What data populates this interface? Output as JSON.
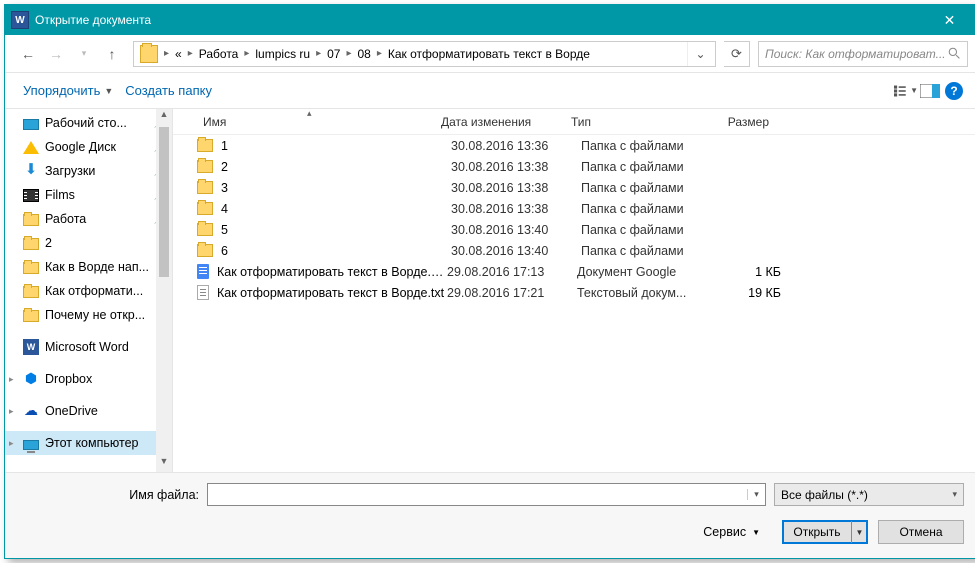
{
  "title": "Открытие документа",
  "breadcrumbs": {
    "prefix": "«",
    "items": [
      "Работа",
      "lumpics ru",
      "07",
      "08",
      "Как отформатировать текст в Ворде"
    ]
  },
  "search_placeholder": "Поиск: Как отформатироват...",
  "toolbar": {
    "organize": "Упорядочить",
    "new_folder": "Создать папку"
  },
  "sidebar": [
    {
      "label": "Рабочий сто...",
      "icon": "desktop",
      "pin": true
    },
    {
      "label": "Google Диск",
      "icon": "gdrive",
      "pin": true
    },
    {
      "label": "Загрузки",
      "icon": "down",
      "pin": true
    },
    {
      "label": "Films",
      "icon": "film",
      "pin": true
    },
    {
      "label": "Работа",
      "icon": "folder",
      "pin": true
    },
    {
      "label": "2",
      "icon": "folder",
      "pin": false
    },
    {
      "label": "Как в Ворде нап...",
      "icon": "folder",
      "pin": false
    },
    {
      "label": "Как отформати...",
      "icon": "folder",
      "pin": false
    },
    {
      "label": "Почему не откр...",
      "icon": "folder",
      "pin": false
    },
    {
      "label": "",
      "icon": "",
      "pin": false
    },
    {
      "label": "Microsoft Word",
      "icon": "word",
      "pin": false
    },
    {
      "label": "",
      "icon": "",
      "pin": false
    },
    {
      "label": "Dropbox",
      "icon": "dropbox",
      "pin": false,
      "caret": true
    },
    {
      "label": "",
      "icon": "",
      "pin": false
    },
    {
      "label": "OneDrive",
      "icon": "onedrive",
      "pin": false,
      "caret": true
    },
    {
      "label": "",
      "icon": "",
      "pin": false
    },
    {
      "label": "Этот компьютер",
      "icon": "pc",
      "pin": false,
      "caret": true,
      "selected": true
    }
  ],
  "columns": {
    "name": "Имя",
    "date": "Дата изменения",
    "type": "Тип",
    "size": "Размер"
  },
  "files": [
    {
      "name": "1",
      "date": "30.08.2016 13:36",
      "type": "Папка с файлами",
      "size": "",
      "ico": "folder"
    },
    {
      "name": "2",
      "date": "30.08.2016 13:38",
      "type": "Папка с файлами",
      "size": "",
      "ico": "folder"
    },
    {
      "name": "3",
      "date": "30.08.2016 13:38",
      "type": "Папка с файлами",
      "size": "",
      "ico": "folder"
    },
    {
      "name": "4",
      "date": "30.08.2016 13:38",
      "type": "Папка с файлами",
      "size": "",
      "ico": "folder"
    },
    {
      "name": "5",
      "date": "30.08.2016 13:40",
      "type": "Папка с файлами",
      "size": "",
      "ico": "folder"
    },
    {
      "name": "6",
      "date": "30.08.2016 13:40",
      "type": "Папка с файлами",
      "size": "",
      "ico": "folder"
    },
    {
      "name": "Как отформатировать текст в Ворде.gd...",
      "date": "29.08.2016 17:13",
      "type": "Документ Google",
      "size": "1 КБ",
      "ico": "gdoc"
    },
    {
      "name": "Как отформатировать текст в Ворде.txt",
      "date": "29.08.2016 17:21",
      "type": "Текстовый докум...",
      "size": "19 КБ",
      "ico": "txt"
    }
  ],
  "footer": {
    "filename_label": "Имя файла:",
    "filename_value": "",
    "filter": "Все файлы (*.*)",
    "service": "Сервис",
    "open": "Открыть",
    "cancel": "Отмена"
  }
}
